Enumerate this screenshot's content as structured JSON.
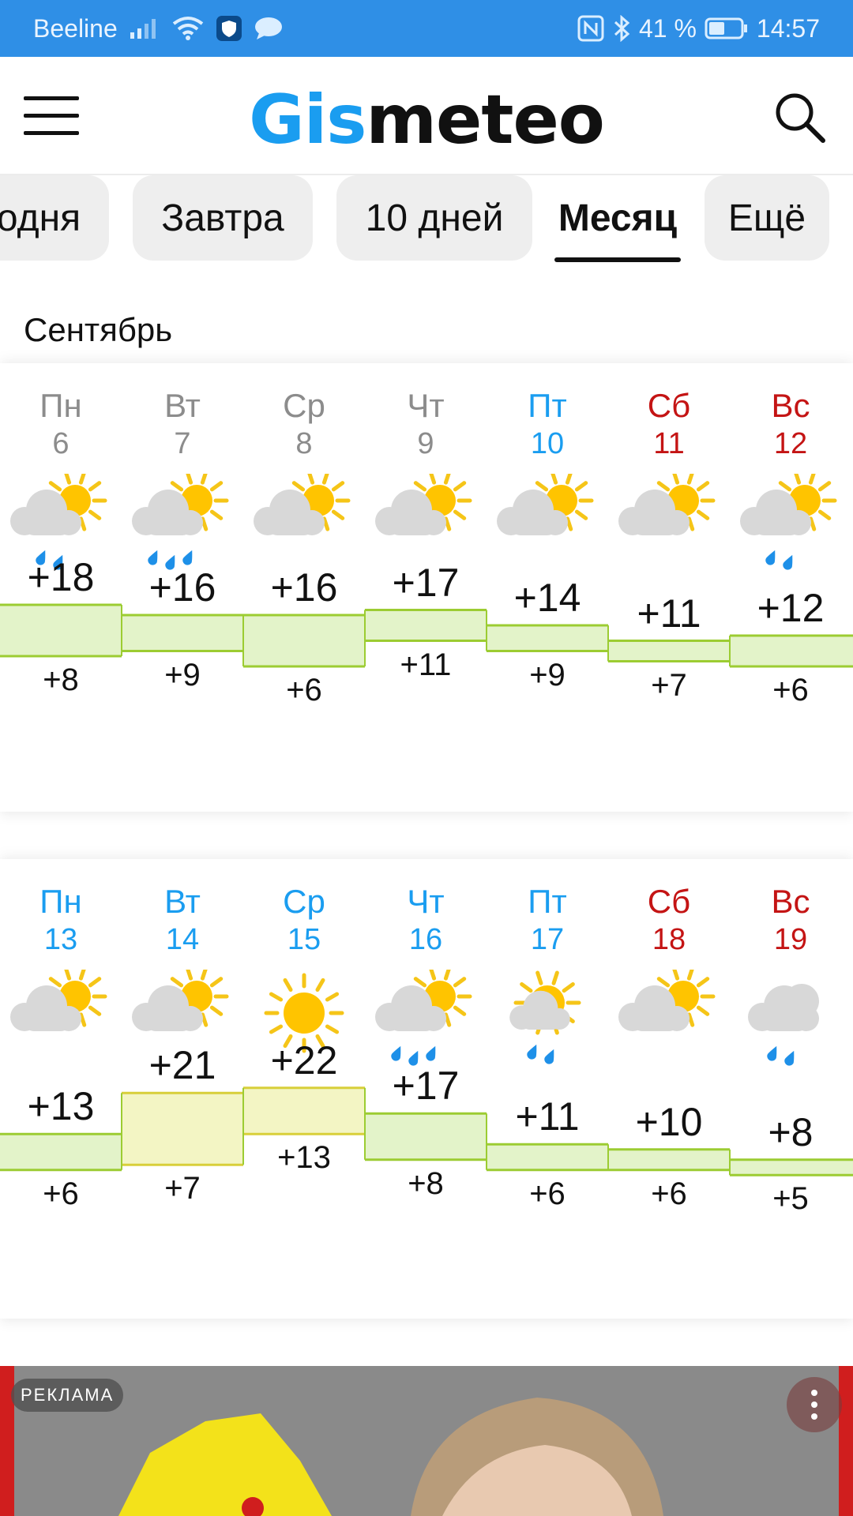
{
  "status_bar": {
    "carrier": "Beeline",
    "battery": "41 %",
    "time": "14:57"
  },
  "header": {
    "logo_part1": "Gis",
    "logo_part2": "meteo"
  },
  "tabs": [
    {
      "label": "одня",
      "active": false
    },
    {
      "label": "Завтра",
      "active": false
    },
    {
      "label": "10 дней",
      "active": false
    },
    {
      "label": "Месяц",
      "active": true
    },
    {
      "label": "Ещё",
      "active": false
    }
  ],
  "month": "Сентябрь",
  "weeks": [
    [
      {
        "name": "Пн",
        "num": "6",
        "color": "gray",
        "icon": "partly-cloudy-light-rain-icon",
        "max": "+18",
        "min": "+8",
        "maxv": 18,
        "minv": 8
      },
      {
        "name": "Вт",
        "num": "7",
        "color": "gray",
        "icon": "partly-cloudy-rain-icon",
        "max": "+16",
        "min": "+9",
        "maxv": 16,
        "minv": 9
      },
      {
        "name": "Ср",
        "num": "8",
        "color": "gray",
        "icon": "partly-cloudy-icon",
        "max": "+16",
        "min": "+6",
        "maxv": 16,
        "minv": 6
      },
      {
        "name": "Чт",
        "num": "9",
        "color": "gray",
        "icon": "partly-cloudy-icon",
        "max": "+17",
        "min": "+11",
        "maxv": 17,
        "minv": 11
      },
      {
        "name": "Пт",
        "num": "10",
        "color": "blue",
        "icon": "partly-cloudy-icon",
        "max": "+14",
        "min": "+9",
        "maxv": 14,
        "minv": 9
      },
      {
        "name": "Сб",
        "num": "11",
        "color": "red",
        "icon": "partly-cloudy-icon",
        "max": "+11",
        "min": "+7",
        "maxv": 11,
        "minv": 7
      },
      {
        "name": "Вс",
        "num": "12",
        "color": "red",
        "icon": "partly-cloudy-light-rain-icon",
        "max": "+12",
        "min": "+6",
        "maxv": 12,
        "minv": 6
      }
    ],
    [
      {
        "name": "Пн",
        "num": "13",
        "color": "blue",
        "icon": "partly-cloudy-icon",
        "max": "+13",
        "min": "+6",
        "maxv": 13,
        "minv": 6
      },
      {
        "name": "Вт",
        "num": "14",
        "color": "blue",
        "icon": "partly-cloudy-icon",
        "max": "+21",
        "min": "+7",
        "maxv": 21,
        "minv": 7
      },
      {
        "name": "Ср",
        "num": "15",
        "color": "blue",
        "icon": "sunny-icon",
        "max": "+22",
        "min": "+13",
        "maxv": 22,
        "minv": 13
      },
      {
        "name": "Чт",
        "num": "16",
        "color": "blue",
        "icon": "partly-cloudy-rain-icon",
        "max": "+17",
        "min": "+8",
        "maxv": 17,
        "minv": 8
      },
      {
        "name": "Пт",
        "num": "17",
        "color": "blue",
        "icon": "sun-small-cloud-light-rain-icon",
        "max": "+11",
        "min": "+6",
        "maxv": 11,
        "minv": 6
      },
      {
        "name": "Сб",
        "num": "18",
        "color": "red",
        "icon": "partly-cloudy-icon",
        "max": "+10",
        "min": "+6",
        "maxv": 10,
        "minv": 6
      },
      {
        "name": "Вс",
        "num": "19",
        "color": "red",
        "icon": "cloudy-rain-icon",
        "max": "+8",
        "min": "+5",
        "maxv": 8,
        "minv": 5
      }
    ]
  ],
  "ad": {
    "label": "РЕКЛАМА"
  },
  "colors": {
    "accent": "#1a9df0",
    "weekend": "#c41414",
    "statusbar": "#2f8fe6",
    "temp_fill": "#e3f3c9",
    "temp_fill_warm": "#f3f5c4",
    "temp_line": "#9ccc32",
    "temp_line_warm": "#d8cf3a"
  }
}
